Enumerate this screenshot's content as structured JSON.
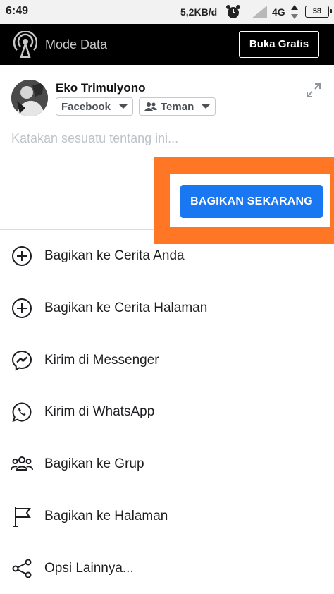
{
  "status_bar": {
    "time": "6:49",
    "net_speed": "5,2KB/d",
    "network_type": "4G",
    "battery": "58"
  },
  "mode_bar": {
    "title": "Mode Data",
    "button_label": "Buka Gratis"
  },
  "composer": {
    "user_name": "Eko Trimulyono",
    "destination_label": "Facebook",
    "audience_label": "Teman",
    "placeholder": "Katakan sesuatu tentang ini...",
    "share_now_label": "BAGIKAN SEKARANG"
  },
  "menu": {
    "items": [
      {
        "label": "Bagikan ke Cerita Anda",
        "icon": "plus-circle-icon"
      },
      {
        "label": "Bagikan ke Cerita Halaman",
        "icon": "plus-circle-icon"
      },
      {
        "label": "Kirim di Messenger",
        "icon": "messenger-icon"
      },
      {
        "label": "Kirim di WhatsApp",
        "icon": "whatsapp-icon"
      },
      {
        "label": "Bagikan ke Grup",
        "icon": "group-icon"
      },
      {
        "label": "Bagikan ke Halaman",
        "icon": "flag-icon"
      },
      {
        "label": "Opsi Lainnya...",
        "icon": "share-icon"
      }
    ]
  },
  "colors": {
    "accent": "#1a77f2",
    "highlight": "#ff7625",
    "mode_bar_bg": "#000000"
  }
}
